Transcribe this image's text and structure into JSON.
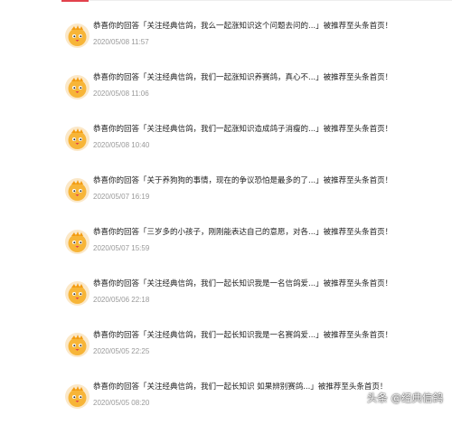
{
  "notifications": [
    {
      "prefix": "恭喜你的回答",
      "quote": "「关注经典信鸽，我么一起涨知识这个问题去问的...」",
      "suffix": "被推荐至头条首页！",
      "timestamp": "2020/05/08 11:57"
    },
    {
      "prefix": "恭喜你的回答",
      "quote": "「关注经典信鸽，我们一起涨知识养赛鸽，真心不...」",
      "suffix": "被推荐至头条首页！",
      "timestamp": "2020/05/08 11:06"
    },
    {
      "prefix": "恭喜你的回答",
      "quote": "「关注经典信鸽，我们一起涨知识造成鸽子消瘦的...」",
      "suffix": "被推荐至头条首页！",
      "timestamp": "2020/05/08 10:40"
    },
    {
      "prefix": "恭喜你的回答",
      "quote": "「关于养狗狗的事情，现在的争议恐怕是最多的了...」",
      "suffix": "被推荐至头条首页！",
      "timestamp": "2020/05/07 16:19"
    },
    {
      "prefix": "恭喜你的回答",
      "quote": "「三岁多的小孩子，刚刚能表达自己的意愿，对各...」",
      "suffix": "被推荐至头条首页！",
      "timestamp": "2020/05/07 15:59"
    },
    {
      "prefix": "恭喜你的回答",
      "quote": "「关注经典信鸽，我们一起长知识我是一名信鸽爱...」",
      "suffix": "被推荐至头条首页！",
      "timestamp": "2020/05/06 22:18"
    },
    {
      "prefix": "恭喜你的回答",
      "quote": "「关注经典信鸽，我们一起长知识我是一名赛鸽爱...」",
      "suffix": "被推荐至头条首页！",
      "timestamp": "2020/05/05 22:25"
    },
    {
      "prefix": "恭喜你的回答",
      "quote": "「关注经典信鸽，我们一起长知识 如果辨别赛鸽...」",
      "suffix": "被推荐至头条首页！",
      "timestamp": "2020/05/05 08:20"
    }
  ],
  "watermark": "头条 @经典信鸽",
  "avatar_icon": "chick-mascot-icon",
  "colors": {
    "accent": "#e2424d",
    "timestamp": "#999999",
    "text": "#222222"
  }
}
